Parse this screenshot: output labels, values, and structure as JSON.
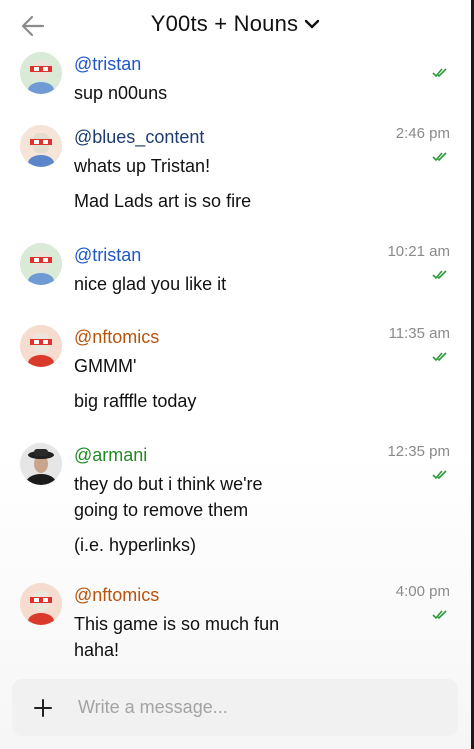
{
  "header": {
    "title": "Y00ts + Nouns"
  },
  "colors": {
    "blue": "#1f57c7",
    "navy": "#1d3d72",
    "orange": "#b9530b",
    "green": "#1f8a24",
    "check": "#2e9b3b"
  },
  "messages": [
    {
      "username": "@tristan",
      "color": "blue",
      "time": "",
      "lines": [
        "sup n00uns"
      ],
      "avatar": "avatar-green-glasses"
    },
    {
      "username": "@blues_content",
      "color": "navy",
      "time": "2:46 pm",
      "lines": [
        "whats up Tristan!",
        "Mad Lads art is so fire"
      ],
      "avatar": "avatar-peach-glasses"
    },
    {
      "username": "@tristan",
      "color": "blue",
      "time": "10:21 am",
      "lines": [
        "nice glad you like it"
      ],
      "avatar": "avatar-green-glasses"
    },
    {
      "username": "@nftomics",
      "color": "orange",
      "time": "11:35 am",
      "lines": [
        "GMMM'",
        "big rafffle today"
      ],
      "avatar": "avatar-red-glasses"
    },
    {
      "username": "@armani",
      "color": "green",
      "time": "12:35 pm",
      "lines": [
        "they do but i think we're",
        "going to remove them",
        "(i.e. hyperlinks)"
      ],
      "avatar": "avatar-dark-hat"
    },
    {
      "username": "@nftomics",
      "color": "orange",
      "time": "4:00 pm",
      "lines": [
        "This game is so much fun",
        "haha!"
      ],
      "avatar": "avatar-red-glasses"
    }
  ],
  "composer": {
    "placeholder": "Write a message..."
  }
}
